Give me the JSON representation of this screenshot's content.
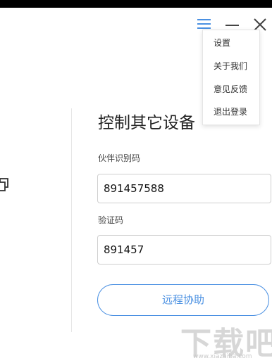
{
  "header": {
    "menu_icon": "menu-icon",
    "minimize_icon": "minimize-icon",
    "close_icon": "close-icon"
  },
  "menu": {
    "items": [
      {
        "label": "设置"
      },
      {
        "label": "关于我们"
      },
      {
        "label": "意见反馈"
      },
      {
        "label": "退出登录"
      }
    ]
  },
  "main": {
    "title": "控制其它设备",
    "partner_id_label": "伙伴识别码",
    "partner_id_value": "891457588",
    "code_label": "验证码",
    "code_value": "891457",
    "assist_button": "远程协助"
  },
  "watermark": {
    "text": "下载吧",
    "subtext": "www.xiazaiba.com"
  },
  "colors": {
    "accent": "#4a90e2",
    "top_bar": "#000000"
  }
}
